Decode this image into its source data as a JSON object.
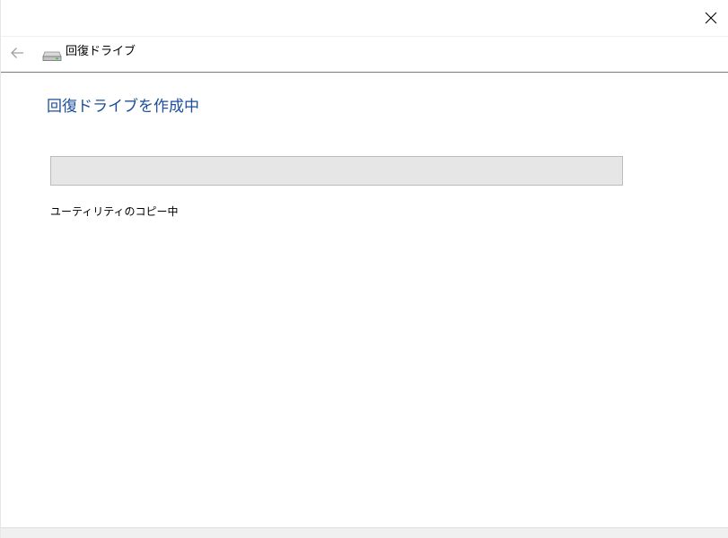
{
  "window": {
    "close_icon": "close-icon"
  },
  "nav": {
    "back_icon": "back-arrow-icon",
    "drive_icon": "drive-icon",
    "title": "回復ドライブ"
  },
  "main": {
    "heading": "回復ドライブを作成中",
    "progress_percent": 0,
    "status": "ユーティリティのコピー中"
  },
  "colors": {
    "heading": "#1c4e9c",
    "progress_track": "#e6e6e6",
    "progress_border": "#bcbcbc",
    "progress_fill": "#06b025"
  }
}
